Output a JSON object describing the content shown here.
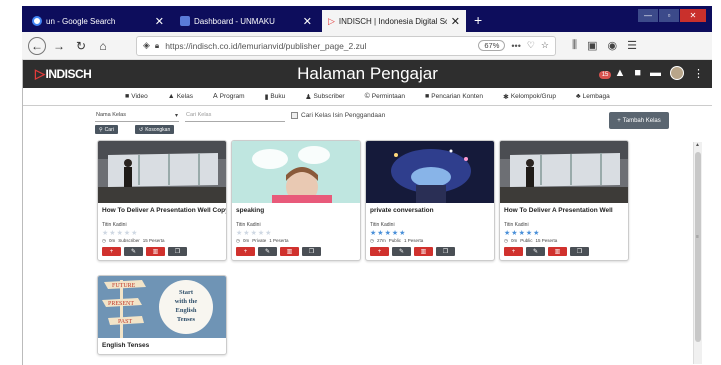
{
  "browser": {
    "tabs": [
      {
        "title": "un - Google Search",
        "active": false,
        "icon_color": "#4285f4"
      },
      {
        "title": "Dashboard - UNMAKU",
        "active": false,
        "icon_color": "#5a7bd8"
      },
      {
        "title": "INDISCH | Indonesia Digital Sch",
        "active": true,
        "icon_color": "#e23b3b"
      }
    ],
    "new_tab": "+",
    "url": "https://indisch.co.id/lemurianvid/publisher_page_2.zul",
    "zoom": "67%",
    "more": "•••"
  },
  "app": {
    "logo_text": "INDISCH",
    "title": "Halaman Pengajar",
    "notif_count": "15",
    "menu": [
      {
        "label": "Video",
        "icon": "video-icon",
        "glyph": "■"
      },
      {
        "label": "Kelas",
        "icon": "class-icon",
        "glyph": "▲"
      },
      {
        "label": "Program",
        "icon": "program-icon",
        "glyph": "A"
      },
      {
        "label": "Buku",
        "icon": "book-icon",
        "glyph": "▮"
      },
      {
        "label": "Subscriber",
        "icon": "subscriber-icon",
        "glyph": "♟"
      },
      {
        "label": "Permintaan",
        "icon": "request-icon",
        "glyph": "©"
      },
      {
        "label": "Pencarian Konten",
        "icon": "search-content-icon",
        "glyph": "■"
      },
      {
        "label": "Kelompok/Grup",
        "icon": "group-icon",
        "glyph": "✱"
      },
      {
        "label": "Lembaga",
        "icon": "institution-icon",
        "glyph": "♣"
      }
    ]
  },
  "filters": {
    "select_value": "Nama Kelas",
    "search_placeholder": "Cari Kelas",
    "checkbox_label": "Cari Kelas Isin Penggandaan",
    "search_button": "Cari",
    "reset_button": "Kosongkan",
    "add_button": "Tambah Kelas"
  },
  "cards": [
    {
      "title": "How To Deliver A Presentation Well Copy",
      "author": "Titin Kadini",
      "rating": 0,
      "meta": [
        "0m",
        "Subscriber",
        "15 Peserta"
      ],
      "thumb": "presentation"
    },
    {
      "title": "speaking",
      "author": "Titin Kadini",
      "rating": 0,
      "meta": [
        "0m",
        "Private",
        "1 Peserta"
      ],
      "thumb": "speaking"
    },
    {
      "title": "private conversation",
      "author": "Titin Kadini",
      "rating": 5,
      "meta": [
        "27m",
        "Public",
        "1 Peserta"
      ],
      "thumb": "private"
    },
    {
      "title": "How To Deliver A Presentation Well",
      "author": "Titin Kadini",
      "rating": 5,
      "meta": [
        "0m",
        "Public",
        "15 Peserta"
      ],
      "thumb": "presentation"
    },
    {
      "title": "English Tenses",
      "author": "",
      "rating": 0,
      "meta": [],
      "thumb": "tenses",
      "thumb_text": [
        "FUTURE",
        "PRESENT",
        "PAST"
      ],
      "thumb_caption": [
        "Start",
        "with the",
        "English",
        "Tenses"
      ]
    }
  ],
  "colors": {
    "accent_red": "#d0312d",
    "star_blue": "#4a90d9",
    "star_empty": "#cfd8e3",
    "header": "#2e2e2e"
  }
}
